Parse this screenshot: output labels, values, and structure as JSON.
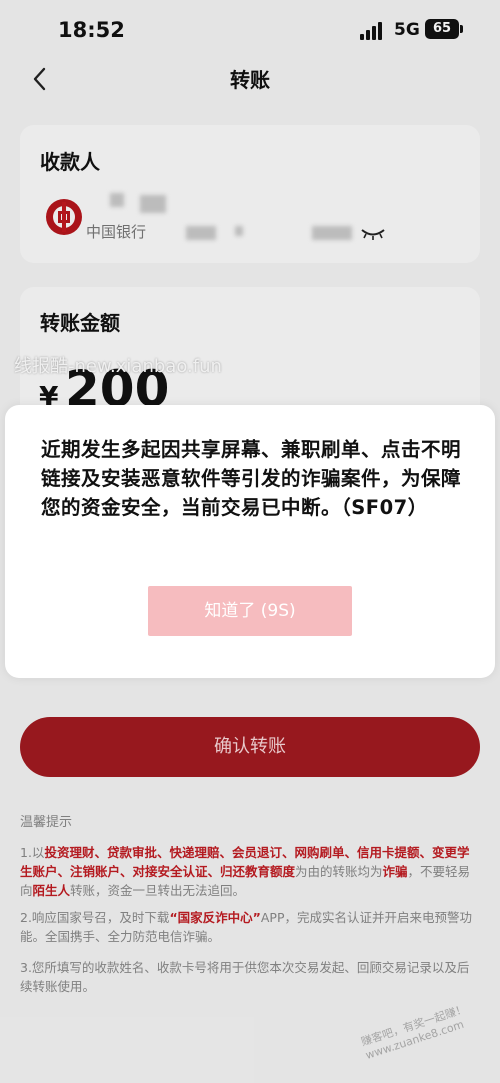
{
  "status_bar": {
    "time": "18:52",
    "network": "5G",
    "battery": "65"
  },
  "nav": {
    "title": "转账",
    "back_icon": "chevron-left-icon"
  },
  "payee": {
    "label": "收款人",
    "bank_name": "中国银行",
    "bank_icon": "bank-of-china-logo"
  },
  "amount": {
    "label": "转账金额",
    "currency": "¥",
    "value": "200"
  },
  "watermark": "线报酷-new.xianbao.fun",
  "confirm_button": "确认转账",
  "tips": {
    "title": "温馨提示",
    "tip1_parts": [
      "1.以",
      "投资理财、贷款审批、快递理赔、会员退订、网购刷单、信用卡提额、变更学生账户、注销账户、对接安全认证、归还教育额度",
      "为由的转账均为",
      "诈骗",
      "，不要轻易向",
      "陌生人",
      "转账，资金一旦转出无法追回。"
    ],
    "tip2_parts": [
      "2.响应国家号召，及时下载",
      "“国家反诈中心”",
      "APP，完成实名认证并开启来电预警功能。全国携手、全力防范电信诈骗。"
    ],
    "tip3": "3.您所填写的收款姓名、收款卡号将用于供您本次交易发起、回顾交易记录以及后续转账使用。"
  },
  "corner_watermark": "赚客吧，有奖一起赚！ www.zuanke8.com",
  "dialog": {
    "message": "近期发生多起因共享屏幕、兼职刷单、点击不明链接及安装恶意软件等引发的诈骗案件，为保障您的资金安全，当前交易已中断。（SF07）",
    "button": "知道了 (9S)"
  },
  "colors": {
    "brand_red": "#a11a20",
    "highlight_red": "#c01c22",
    "dialog_button": "#f6bcbf"
  }
}
